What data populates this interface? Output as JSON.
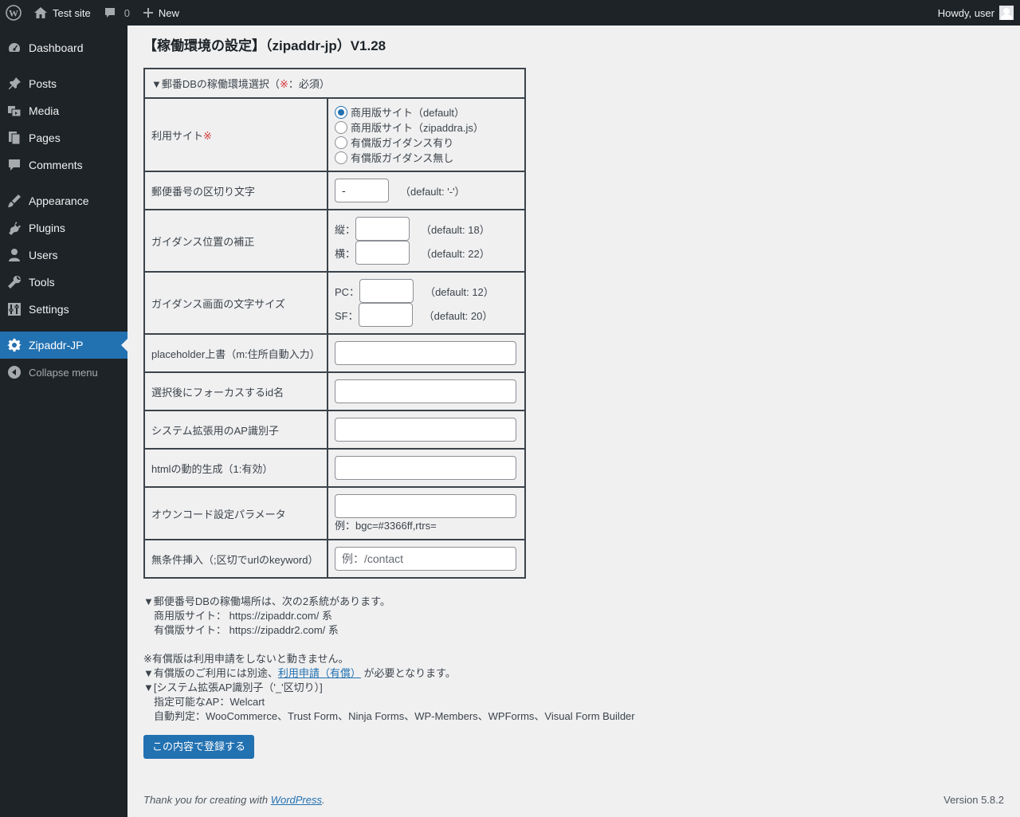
{
  "adminbar": {
    "site_name": "Test site",
    "comments_count": "0",
    "new_label": "New",
    "greeting": "Howdy, user"
  },
  "sidebar": {
    "items": [
      {
        "label": "Dashboard",
        "icon": "dashboard-icon"
      },
      {
        "label": "Posts",
        "icon": "pin-icon"
      },
      {
        "label": "Media",
        "icon": "media-icon"
      },
      {
        "label": "Pages",
        "icon": "pages-icon"
      },
      {
        "label": "Comments",
        "icon": "comment-icon"
      },
      {
        "label": "Appearance",
        "icon": "brush-icon"
      },
      {
        "label": "Plugins",
        "icon": "plug-icon"
      },
      {
        "label": "Users",
        "icon": "user-icon"
      },
      {
        "label": "Tools",
        "icon": "wrench-icon"
      },
      {
        "label": "Settings",
        "icon": "settings-icon"
      },
      {
        "label": "Zipaddr-JP",
        "icon": "gear-icon"
      }
    ],
    "collapse_label": "Collapse menu"
  },
  "page": {
    "title": "【稼働環境の設定】（zipaddr-jp）V1.28"
  },
  "form": {
    "section_header_prefix": "▼郵番DBの稼働環境選択（",
    "section_header_mark": "※",
    "section_header_suffix": "：必須）",
    "site": {
      "label": "利用サイト",
      "mark": "※",
      "options": [
        {
          "label": "商用版サイト（default）",
          "checked": true
        },
        {
          "label": "商用版サイト（zipaddra.js）",
          "checked": false
        },
        {
          "label": "有償版ガイダンス有り",
          "checked": false
        },
        {
          "label": "有償版ガイダンス無し",
          "checked": false
        }
      ]
    },
    "separator": {
      "label": "郵便番号の区切り文字",
      "value": "-",
      "hint": "（default: '-'）"
    },
    "guidance_pos": {
      "label": "ガイダンス位置の補正",
      "v_label": "縦：",
      "v_value": "",
      "v_hint": "（default: 18）",
      "h_label": "横：",
      "h_value": "",
      "h_hint": "（default: 22）"
    },
    "font_size": {
      "label": "ガイダンス画面の文字サイズ",
      "pc_label": "PC：",
      "pc_value": "",
      "pc_hint": "（default: 12）",
      "sf_label": "SF：",
      "sf_value": "",
      "sf_hint": "（default: 20）"
    },
    "placeholder_row": {
      "label": "placeholder上書（m:住所自動入力）",
      "value": ""
    },
    "focus_row": {
      "label": "選択後にフォーカスするid名",
      "value": ""
    },
    "ap_row": {
      "label": "システム拡張用のAP識別子",
      "value": ""
    },
    "html_row": {
      "label": "htmlの動的生成（1:有効）",
      "value": ""
    },
    "owncode_row": {
      "label": "オウンコード設定パラメータ",
      "value": "",
      "example": "例：bgc=#3366ff,rtrs="
    },
    "insert_row": {
      "label": "無条件挿入（;区切でurlのkeyword）",
      "placeholder": "例：/contact"
    }
  },
  "notes": {
    "line1": "▼郵便番号DBの稼働場所は、次の2系統があります。",
    "line2": "商用版サイト： https://zipaddr.com/ 系",
    "line3": "有償版サイト： https://zipaddr2.com/ 系",
    "line4": "※有償版は利用申請をしないと動きません。",
    "line5_prefix": "▼有償版のご利用には別途、",
    "line5_link": "利用申請（有償）",
    "line5_suffix": " が必要となります。",
    "line6": "▼[システム拡張AP識別子（'_'区切り）]",
    "line7": "指定可能なAP：Welcart",
    "line8": "自動判定：WooCommerce、Trust Form、Ninja Forms、WP-Members、WPForms、Visual Form Builder"
  },
  "submit_label": "この内容で登録する",
  "footer": {
    "thanks_prefix": "Thank you for creating with ",
    "thanks_link": "WordPress",
    "thanks_suffix": ".",
    "version": "Version 5.8.2"
  }
}
